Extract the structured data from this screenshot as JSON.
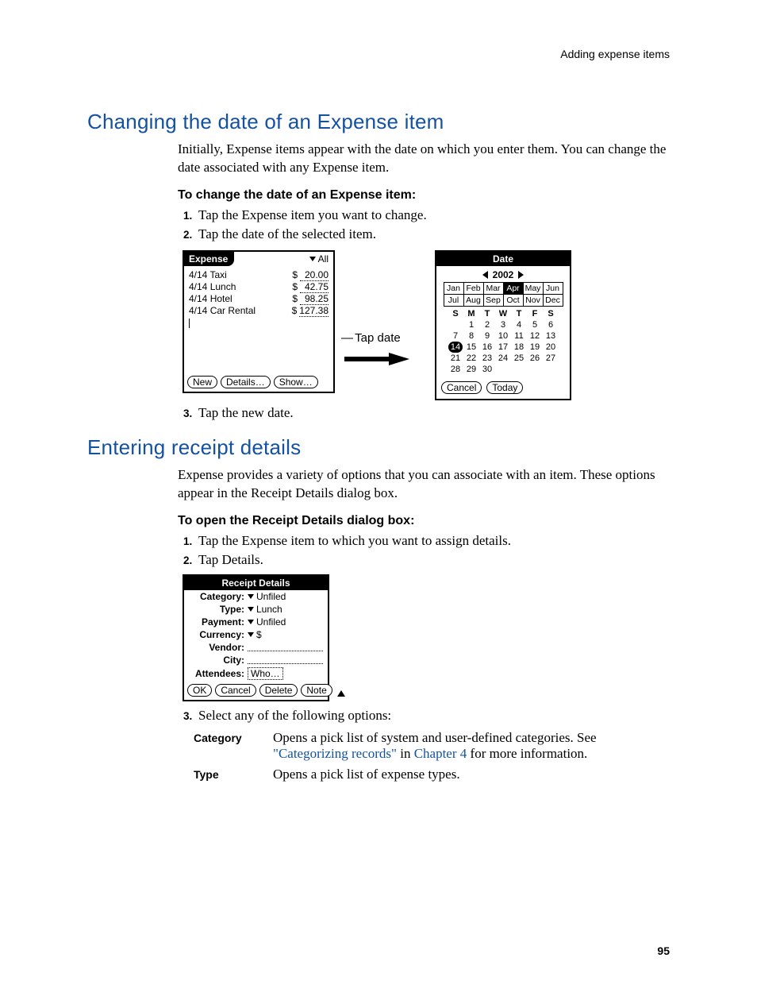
{
  "running_head": "Adding expense items",
  "page_number": "95",
  "section1": {
    "title": "Changing the date of an Expense item",
    "intro": "Initially, Expense items appear with the date on which you enter them. You can change the date associated with any Expense item.",
    "proc_title": "To change the date of an Expense item:",
    "steps": {
      "s1": "Tap the Expense item you want to change.",
      "s2": "Tap the date of the selected item.",
      "s3": "Tap the new date."
    },
    "annot": "Tap date"
  },
  "expense_screen": {
    "title": "Expense",
    "popup_label": "All",
    "rows": [
      {
        "desc": "4/14 Taxi",
        "cur": "$",
        "amt": "20.00"
      },
      {
        "desc": "4/14 Lunch",
        "cur": "$",
        "amt": "42.75"
      },
      {
        "desc": "4/14 Hotel",
        "cur": "$",
        "amt": "98.25"
      },
      {
        "desc": "4/14 Car Rental",
        "cur": "$",
        "amt": "127.38"
      }
    ],
    "buttons": {
      "new": "New",
      "details": "Details…",
      "show": "Show…"
    }
  },
  "date_picker": {
    "title": "Date",
    "year": "2002",
    "months_row1": [
      "Jan",
      "Feb",
      "Mar",
      "Apr",
      "May",
      "Jun"
    ],
    "months_row2": [
      "Jul",
      "Aug",
      "Sep",
      "Oct",
      "Nov",
      "Dec"
    ],
    "selected_month_index": 3,
    "dow": [
      "S",
      "M",
      "T",
      "W",
      "T",
      "F",
      "S"
    ],
    "weeks": [
      [
        "",
        "1",
        "2",
        "3",
        "4",
        "5",
        "6"
      ],
      [
        "7",
        "8",
        "9",
        "10",
        "11",
        "12",
        "13"
      ],
      [
        "14",
        "15",
        "16",
        "17",
        "18",
        "19",
        "20"
      ],
      [
        "21",
        "22",
        "23",
        "24",
        "25",
        "26",
        "27"
      ],
      [
        "28",
        "29",
        "30",
        "",
        "",
        "",
        ""
      ]
    ],
    "selected_day": "14",
    "buttons": {
      "cancel": "Cancel",
      "today": "Today"
    }
  },
  "section2": {
    "title": "Entering receipt details",
    "intro": "Expense provides a variety of options that you can associate with an item. These options appear in the Receipt Details dialog box.",
    "proc_title": "To open the Receipt Details dialog box:",
    "steps": {
      "s1": "Tap the Expense item to which you want to assign details.",
      "s2": "Tap Details.",
      "s3": "Select any of the following options:"
    }
  },
  "receipt_dialog": {
    "title": "Receipt Details",
    "fields": {
      "category": {
        "label": "Category:",
        "value": "Unfiled"
      },
      "type": {
        "label": "Type:",
        "value": "Lunch"
      },
      "payment": {
        "label": "Payment:",
        "value": "Unfiled"
      },
      "currency": {
        "label": "Currency:",
        "value": "$"
      },
      "vendor": {
        "label": "Vendor:"
      },
      "city": {
        "label": "City:"
      },
      "attendees": {
        "label": "Attendees:",
        "value": "Who…"
      }
    },
    "buttons": {
      "ok": "OK",
      "cancel": "Cancel",
      "delete": "Delete",
      "note": "Note"
    }
  },
  "options": {
    "category": {
      "term": "Category",
      "def_a": "Opens a pick list of system and user-defined categories. See ",
      "xref1": "\"Categorizing records\"",
      "def_b": " in ",
      "xref2": "Chapter 4",
      "def_c": " for more information."
    },
    "type": {
      "term": "Type",
      "def": "Opens a pick list of expense types."
    }
  }
}
